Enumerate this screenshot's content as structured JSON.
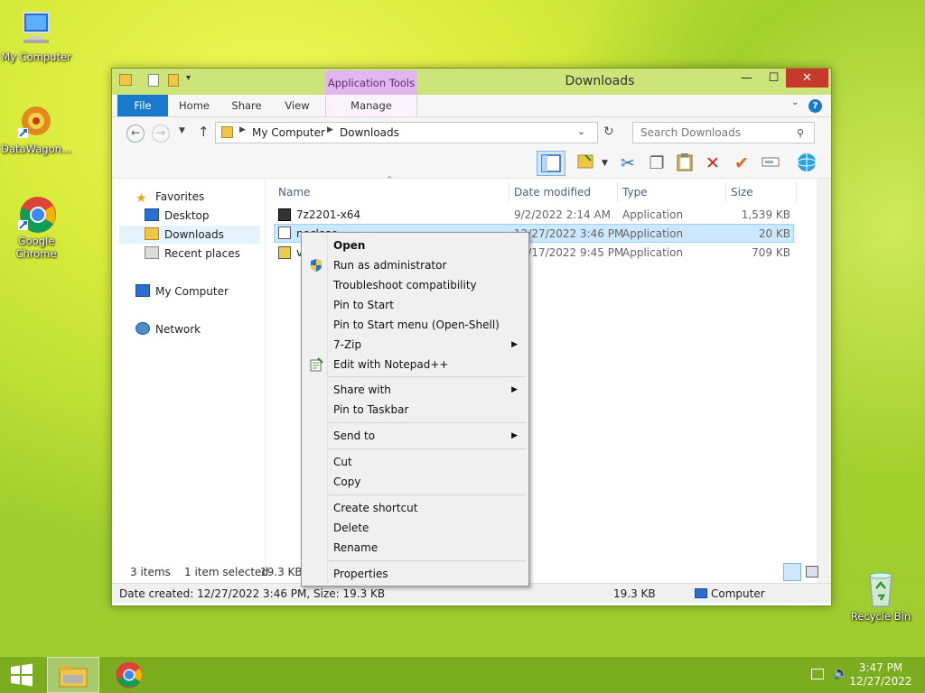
{
  "desktop": {
    "icons": [
      {
        "label": "My Computer"
      },
      {
        "label": "DataWagon..."
      },
      {
        "label": "Google Chrome"
      },
      {
        "label": "Recycle Bin"
      }
    ]
  },
  "window": {
    "title": "Downloads",
    "app_tools_label": "Application Tools",
    "tabs": [
      "File",
      "Home",
      "Share",
      "View",
      "Manage"
    ],
    "address": {
      "segments": [
        "My Computer",
        "Downloads"
      ]
    },
    "search": {
      "placeholder": "Search Downloads"
    },
    "nav": {
      "favorites": "Favorites",
      "favorites_items": [
        "Desktop",
        "Downloads",
        "Recent places"
      ],
      "computer": "My Computer",
      "network": "Network"
    },
    "columns": [
      "Name",
      "Date modified",
      "Type",
      "Size"
    ],
    "files": [
      {
        "name": "7z2201-x64",
        "date": "9/2/2022 2:14 AM",
        "type": "Application",
        "size": "1,539 KB"
      },
      {
        "name": "noclose",
        "date": "12/27/2022 3:46 PM",
        "type": "Application",
        "size": "20 KB"
      },
      {
        "name": "v",
        "date": "12/17/2022 9:45 PM",
        "type": "Application",
        "size": "709 KB"
      }
    ],
    "status": {
      "items": "3 items",
      "selected": "1 item selected",
      "size": "19.3 KB"
    },
    "details": {
      "info": "Date created: 12/27/2022 3:46 PM, Size: 19.3 KB",
      "size": "19.3 KB",
      "location": "Computer"
    }
  },
  "context_menu": {
    "items": [
      "Open",
      "Run as administrator",
      "Troubleshoot compatibility",
      "Pin to Start",
      "Pin to Start menu (Open-Shell)",
      "7-Zip",
      "Edit with Notepad++",
      "Share with",
      "Pin to Taskbar",
      "Send to",
      "Cut",
      "Copy",
      "Create shortcut",
      "Delete",
      "Rename",
      "Properties"
    ]
  },
  "taskbar": {
    "time": "3:47 PM",
    "date": "12/27/2022"
  }
}
